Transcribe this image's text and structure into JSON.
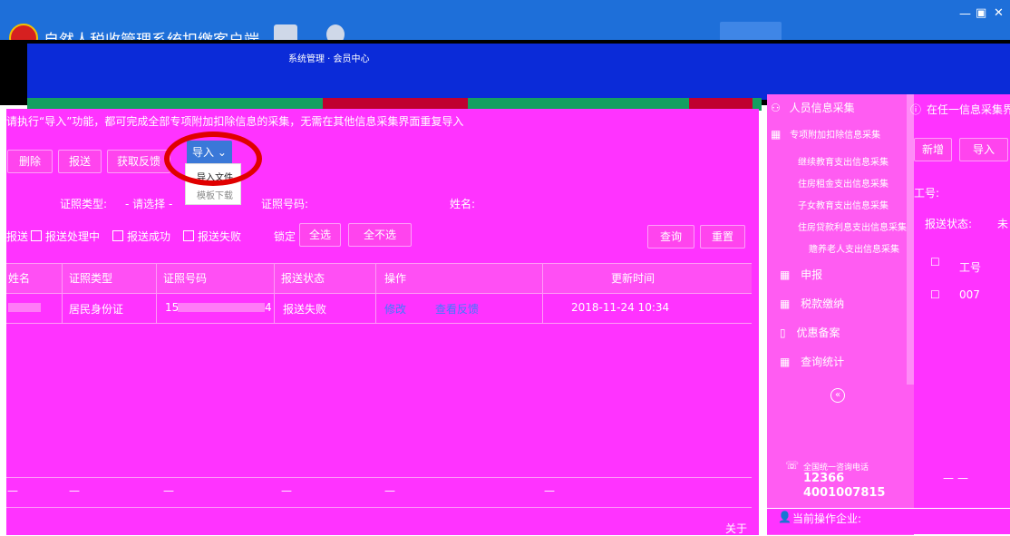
{
  "window": {
    "title": "自然人税收管理系统扣缴客户端",
    "controls": [
      "—",
      "▣",
      "✕"
    ],
    "toolbar_caption": "系统管理 · 会员中心"
  },
  "notice": "请执行“导入”功能，都可完成全部专项附加扣除信息的采集，无需在其他信息采集界面重复导入",
  "toolbar": {
    "delete": "删除",
    "report": "报送",
    "feedback": "获取反馈",
    "import": "导入",
    "import_menu": [
      "导入文件",
      "模板下载"
    ]
  },
  "filters": {
    "id_type_label": "证照类型:",
    "id_type_value": "- 请选择 -",
    "id_no_label": "证照号码:",
    "name_label": "姓名:"
  },
  "status_filters": {
    "unreported": "报送",
    "processing": "报送处理中",
    "success": "报送成功",
    "failure": "报送失败",
    "lock_label": "锁定",
    "select_all": "全选",
    "deselect_all": "全不选",
    "query": "查询",
    "reset": "重置"
  },
  "table": {
    "headers": [
      "姓名",
      "证照类型",
      "证照号码",
      "报送状态",
      "操作",
      "更新时间"
    ],
    "rows": [
      {
        "name": "",
        "id_type": "居民身份证",
        "id_no": "15",
        "id_no_tail": "4",
        "status": "报送失败",
        "action_edit": "修改",
        "action_feedback": "查看反馈",
        "updated": "2018-11-24 10:34"
      }
    ],
    "footer": [
      "—",
      "—",
      "—",
      "—",
      "—",
      "—"
    ]
  },
  "about": "关于",
  "sidebar": {
    "items": [
      {
        "label": "人员信息采集",
        "icon": "people-icon"
      },
      {
        "label": "专项附加扣除信息采集",
        "icon": "grid-icon"
      }
    ],
    "sub_items": [
      "继续教育支出信息采集",
      "住房租金支出信息采集",
      "子女教育支出信息采集",
      "住房贷款利息支出信息采集",
      "赡养老人支出信息采集"
    ],
    "sections": [
      {
        "label": "申报",
        "icon": "grid-icon"
      },
      {
        "label": "税款缴纳",
        "icon": "grid-icon"
      },
      {
        "label": "优惠备案",
        "icon": "doc-icon"
      },
      {
        "label": "查询统计",
        "icon": "grid-icon"
      }
    ],
    "collapse": "«",
    "hotline_label": "全国统一咨询电话",
    "hotline_1": "12366",
    "hotline_2": "4001007815",
    "current_company_label": "当前操作企业:"
  },
  "right_panel": {
    "info": "在任一信息采集界",
    "new": "新增",
    "import": "导入",
    "work_no_label": "工号:",
    "status_label": "报送状态:",
    "status_value": "未",
    "col_header": "工号",
    "row_value": "007",
    "footer": [
      "—",
      "—"
    ]
  },
  "colors": {
    "accent": "#1e6fd9",
    "panel": "#ff33ff",
    "highlight_circle": "#e00000"
  }
}
